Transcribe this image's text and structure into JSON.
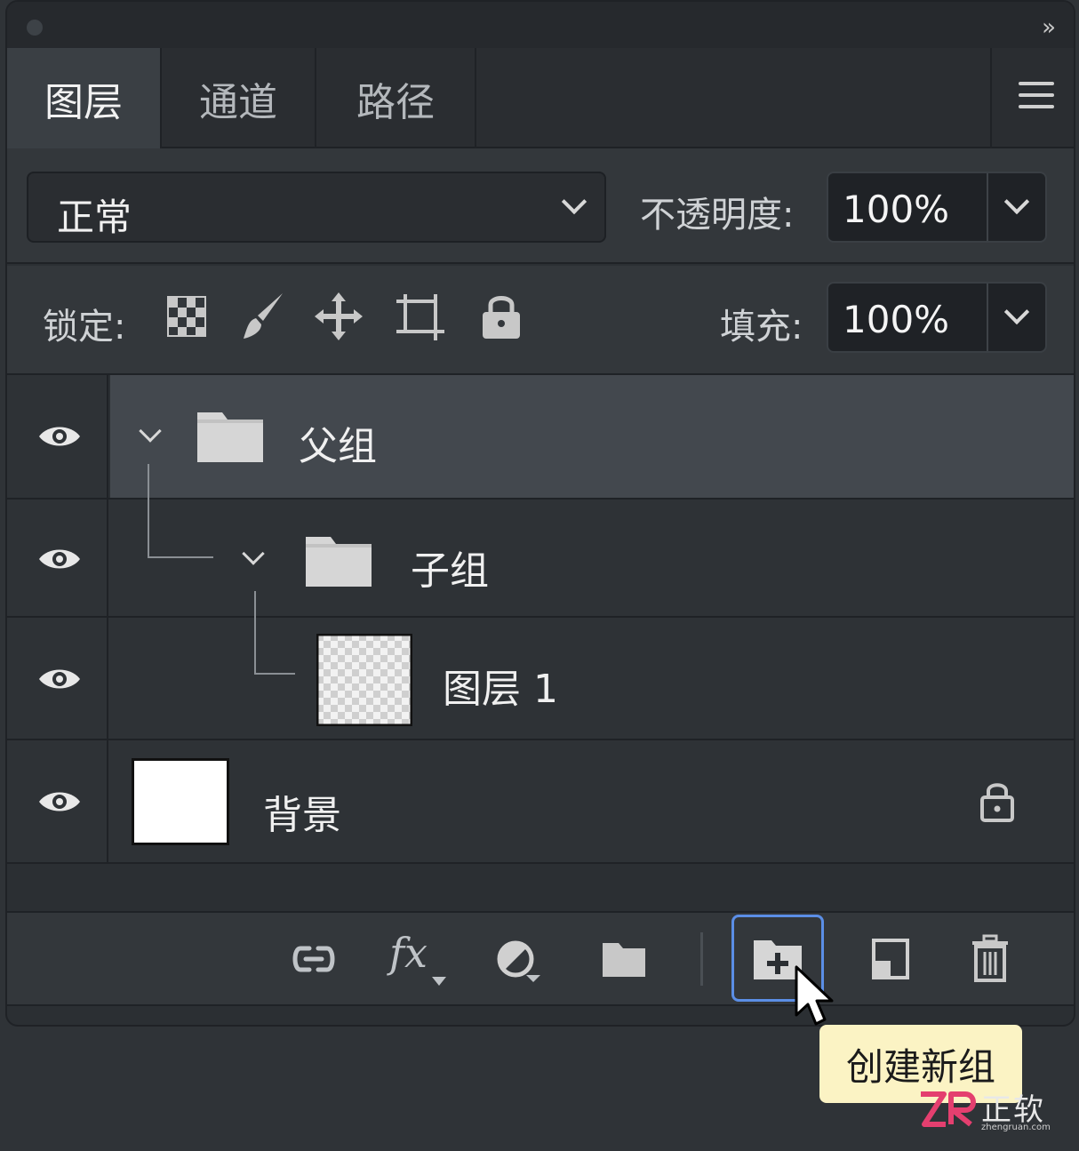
{
  "tabs": [
    {
      "label": "图层",
      "active": true
    },
    {
      "label": "通道",
      "active": false
    },
    {
      "label": "路径",
      "active": false
    }
  ],
  "blend_mode": {
    "value": "正常"
  },
  "opacity": {
    "label": "不透明度:",
    "value": "100%"
  },
  "lock": {
    "label": "锁定:",
    "icons": [
      "lock-transparent-pixels-icon",
      "lock-image-pixels-icon",
      "lock-position-icon",
      "lock-artboard-icon",
      "lock-all-icon"
    ]
  },
  "fill": {
    "label": "填充:",
    "value": "100%"
  },
  "layers": [
    {
      "name": "父组",
      "type": "group",
      "expanded": true,
      "selected": true
    },
    {
      "name": "子组",
      "type": "group",
      "expanded": true,
      "selected": false
    },
    {
      "name": "图层 1",
      "type": "layer",
      "thumbnail": "transparent",
      "selected": false
    },
    {
      "name": "背景",
      "type": "background",
      "thumbnail": "white",
      "locked": true,
      "selected": false
    }
  ],
  "footer_icons": [
    "link-layers-icon",
    "fx-icon",
    "adjustment-layer-icon",
    "folder-icon",
    "new-group-icon",
    "new-layer-icon",
    "trash-icon"
  ],
  "tooltip": {
    "text": "创建新组"
  },
  "watermark": {
    "text": "正软",
    "sub": "zhengruan.com"
  },
  "colors": {
    "selection": "#43484e",
    "highlight": "#5b8ee6",
    "tooltip_bg": "#fbf3c4"
  }
}
